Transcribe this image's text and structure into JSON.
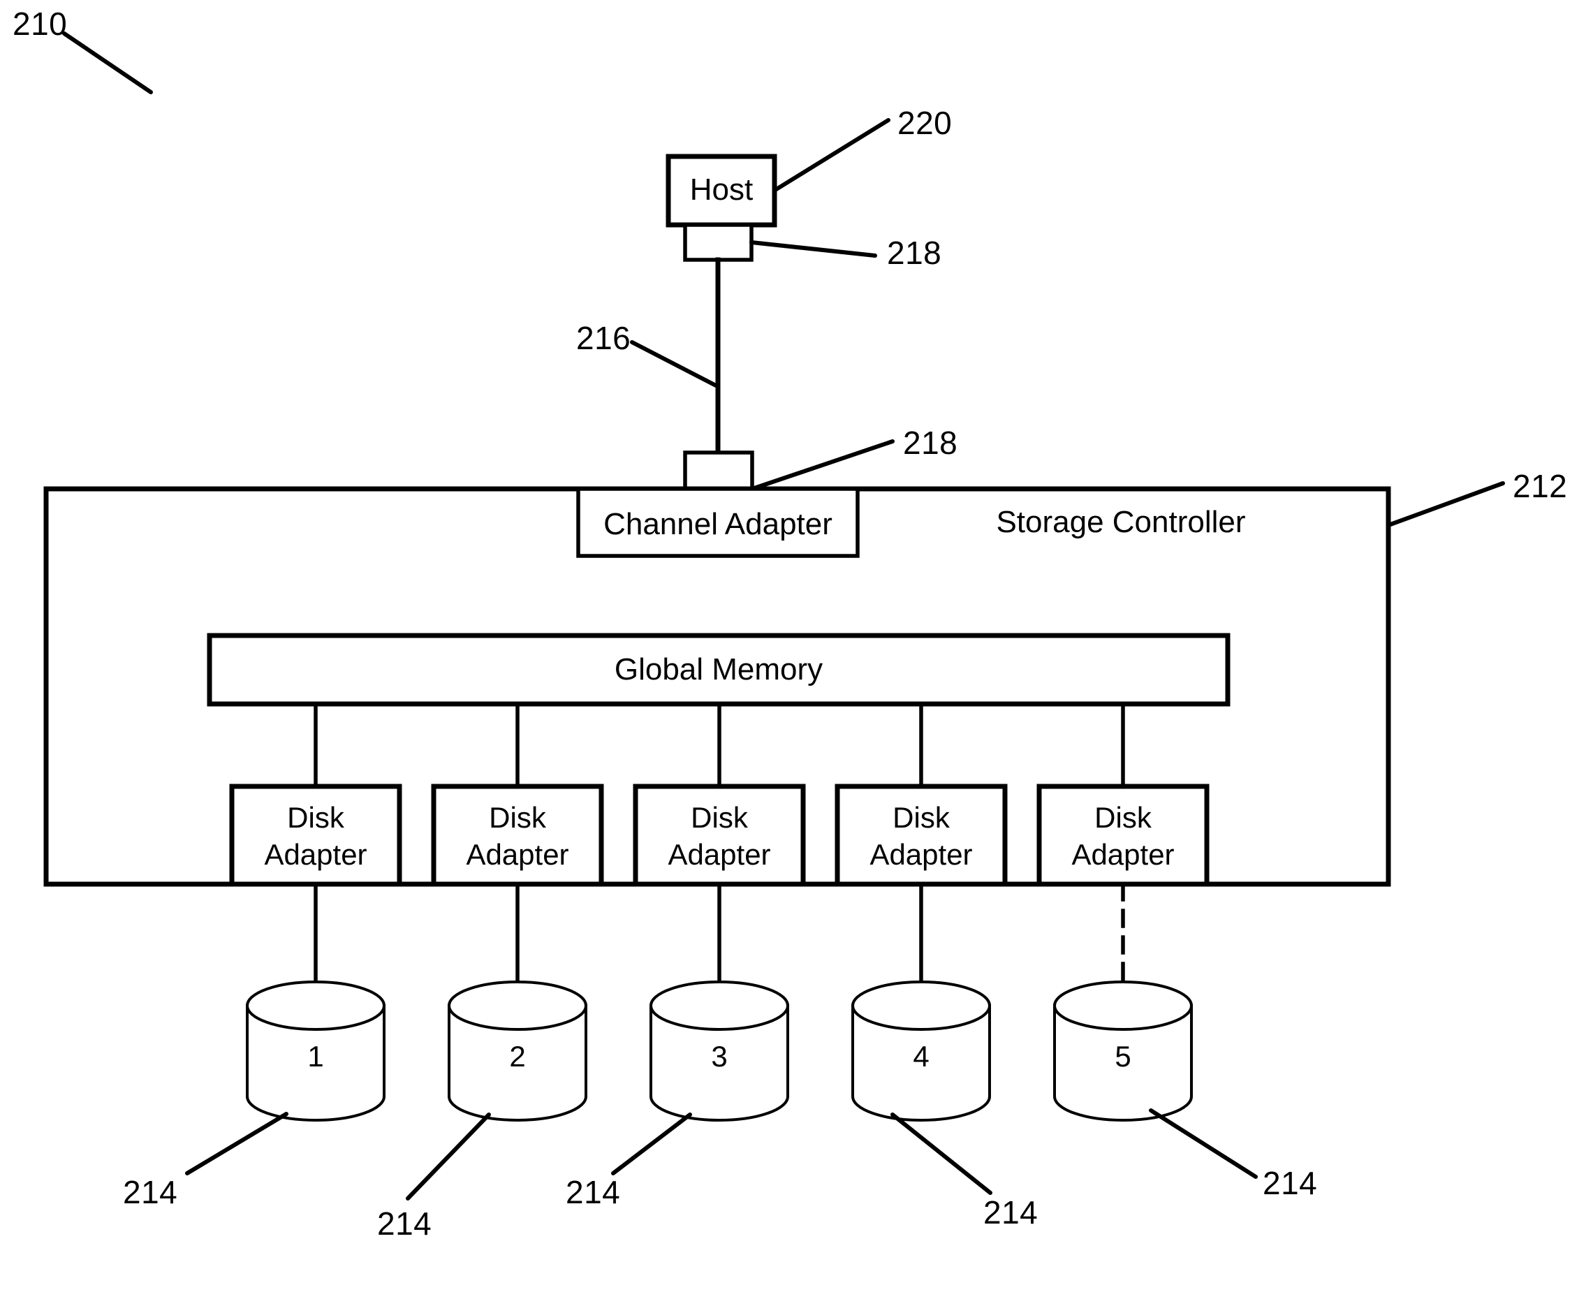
{
  "figure": {
    "title_ref": "210",
    "nodes": {
      "host": {
        "label": "Host",
        "ref": "220"
      },
      "host_adapter": {
        "ref": "218"
      },
      "link": {
        "ref": "216"
      },
      "controller_adapter": {
        "ref": "218"
      },
      "channel_adapter": {
        "label": "Channel Adapter"
      },
      "storage_controller": {
        "label": "Storage Controller",
        "ref": "212"
      },
      "global_memory": {
        "label": "Global Memory"
      }
    },
    "disk_adapters": [
      {
        "line1": "Disk",
        "line2": "Adapter"
      },
      {
        "line1": "Disk",
        "line2": "Adapter"
      },
      {
        "line1": "Disk",
        "line2": "Adapter"
      },
      {
        "line1": "Disk",
        "line2": "Adapter"
      },
      {
        "line1": "Disk",
        "line2": "Adapter"
      }
    ],
    "disks": [
      {
        "number": "1",
        "ref": "214"
      },
      {
        "number": "2",
        "ref": "214"
      },
      {
        "number": "3",
        "ref": "214"
      },
      {
        "number": "4",
        "ref": "214"
      },
      {
        "number": "5",
        "ref": "214"
      }
    ],
    "colors": {
      "stroke": "#000000",
      "background": "#ffffff"
    }
  }
}
